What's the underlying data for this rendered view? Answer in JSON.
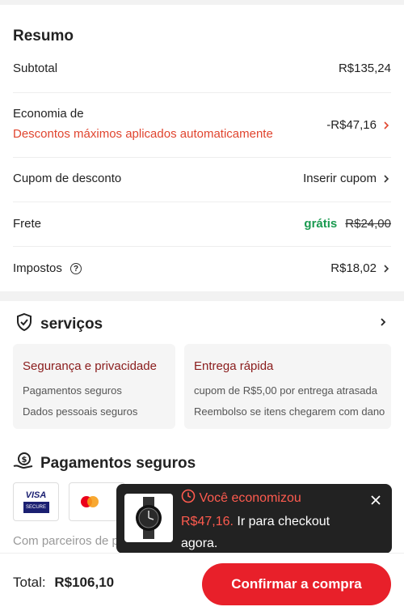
{
  "summary": {
    "title": "Resumo",
    "subtotal_label": "Subtotal",
    "subtotal_value": "R$135,24",
    "economy_label": "Economia de",
    "economy_link": "Descontos máximos aplicados automaticamente",
    "economy_value": "-R$47,16",
    "coupon_label": "Cupom de desconto",
    "coupon_action": "Inserir cupom",
    "shipping_label": "Frete",
    "shipping_free": "grátis",
    "shipping_old": "R$24,00",
    "taxes_label": "Impostos",
    "taxes_value": "R$18,02"
  },
  "services": {
    "title": "serviços",
    "cards": [
      {
        "title": "Segurança e privacidade",
        "lines": [
          "Pagamentos seguros",
          "Dados pessoais seguros"
        ]
      },
      {
        "title": "Entrega rápida",
        "lines": [
          "cupom de R$5,00 por entrega atrasada",
          "Reembolso se itens chegarem com dano"
        ]
      }
    ]
  },
  "payments": {
    "title": "Pagamentos seguros",
    "visa_label": "VISA",
    "visa_secure": "SECURE",
    "partners_text": "Com parceiros de pagamento populares, seus dados pessoais"
  },
  "bottom": {
    "total_label": "Total:",
    "total_value": "R$106,10",
    "confirm_label": "Confirmar a compra"
  },
  "toast": {
    "line1": "Você economizou",
    "amount": "R$47,16.",
    "rest": "Ir para checkout agora."
  },
  "colors": {
    "accent_red": "#e8202a",
    "discount_red": "#e0442e",
    "free_green": "#1a9a50",
    "service_title": "#8a1c1c"
  }
}
